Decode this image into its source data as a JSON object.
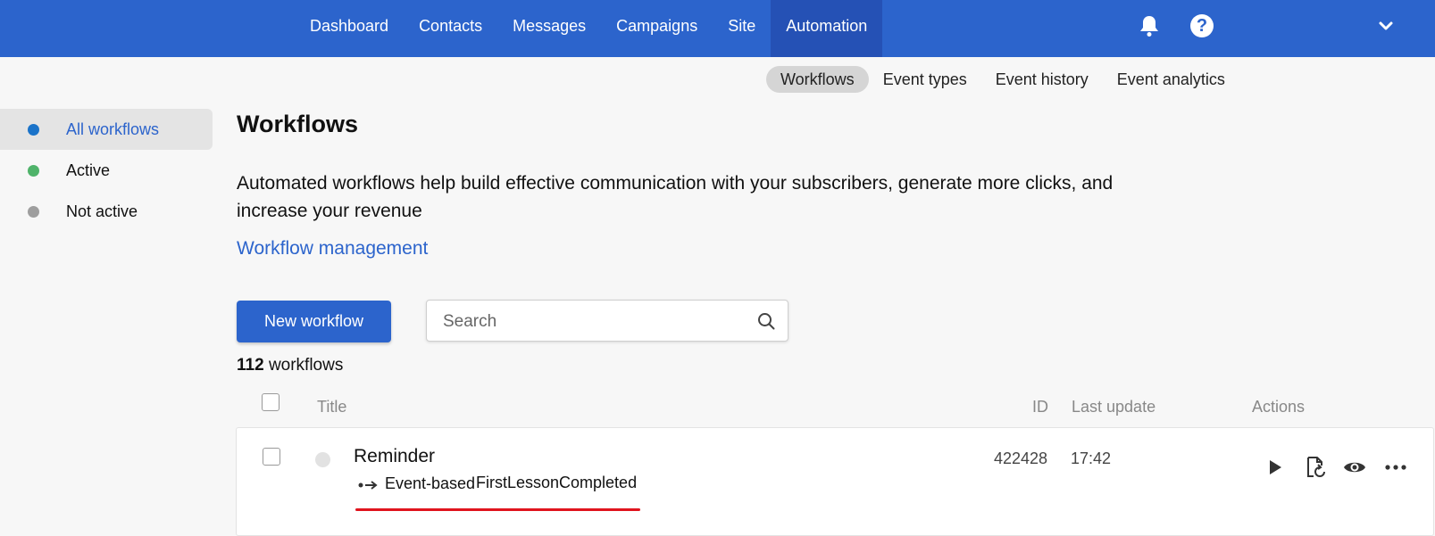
{
  "topnav": {
    "items": [
      "Dashboard",
      "Contacts",
      "Messages",
      "Campaigns",
      "Site",
      "Automation"
    ],
    "active": "Automation",
    "icons": [
      "bell-icon",
      "help-icon",
      "chevron-down-icon"
    ]
  },
  "subnav": {
    "items": [
      "Workflows",
      "Event types",
      "Event history",
      "Event analytics"
    ],
    "active": "Workflows"
  },
  "sidebar": {
    "items": [
      {
        "label": "All workflows",
        "dot_color": "#1a73c9"
      },
      {
        "label": "Active",
        "dot_color": "#4fb36a"
      },
      {
        "label": "Not active",
        "dot_color": "#9e9e9e"
      }
    ]
  },
  "main": {
    "title": "Workflows",
    "description": "Automated workflows help build effective communication with your subscribers, generate more clicks, and increase your revenue",
    "management_link": "Workflow management",
    "new_button": "New workflow",
    "search_placeholder": "Search",
    "count_number": "112",
    "count_label": "workflows"
  },
  "table": {
    "headers": {
      "title": "Title",
      "id": "ID",
      "last_update": "Last update",
      "actions": "Actions"
    },
    "rows": [
      {
        "name": "Reminder",
        "type": "Event-based",
        "event": "FirstLessonCompleted",
        "id": "422428",
        "last_update": "17:42",
        "actions": [
          "play-icon",
          "document-refresh-icon",
          "eye-icon",
          "more-icon"
        ]
      }
    ]
  },
  "colors": {
    "brand": "#2c64cc",
    "underline": "#e0141e"
  }
}
